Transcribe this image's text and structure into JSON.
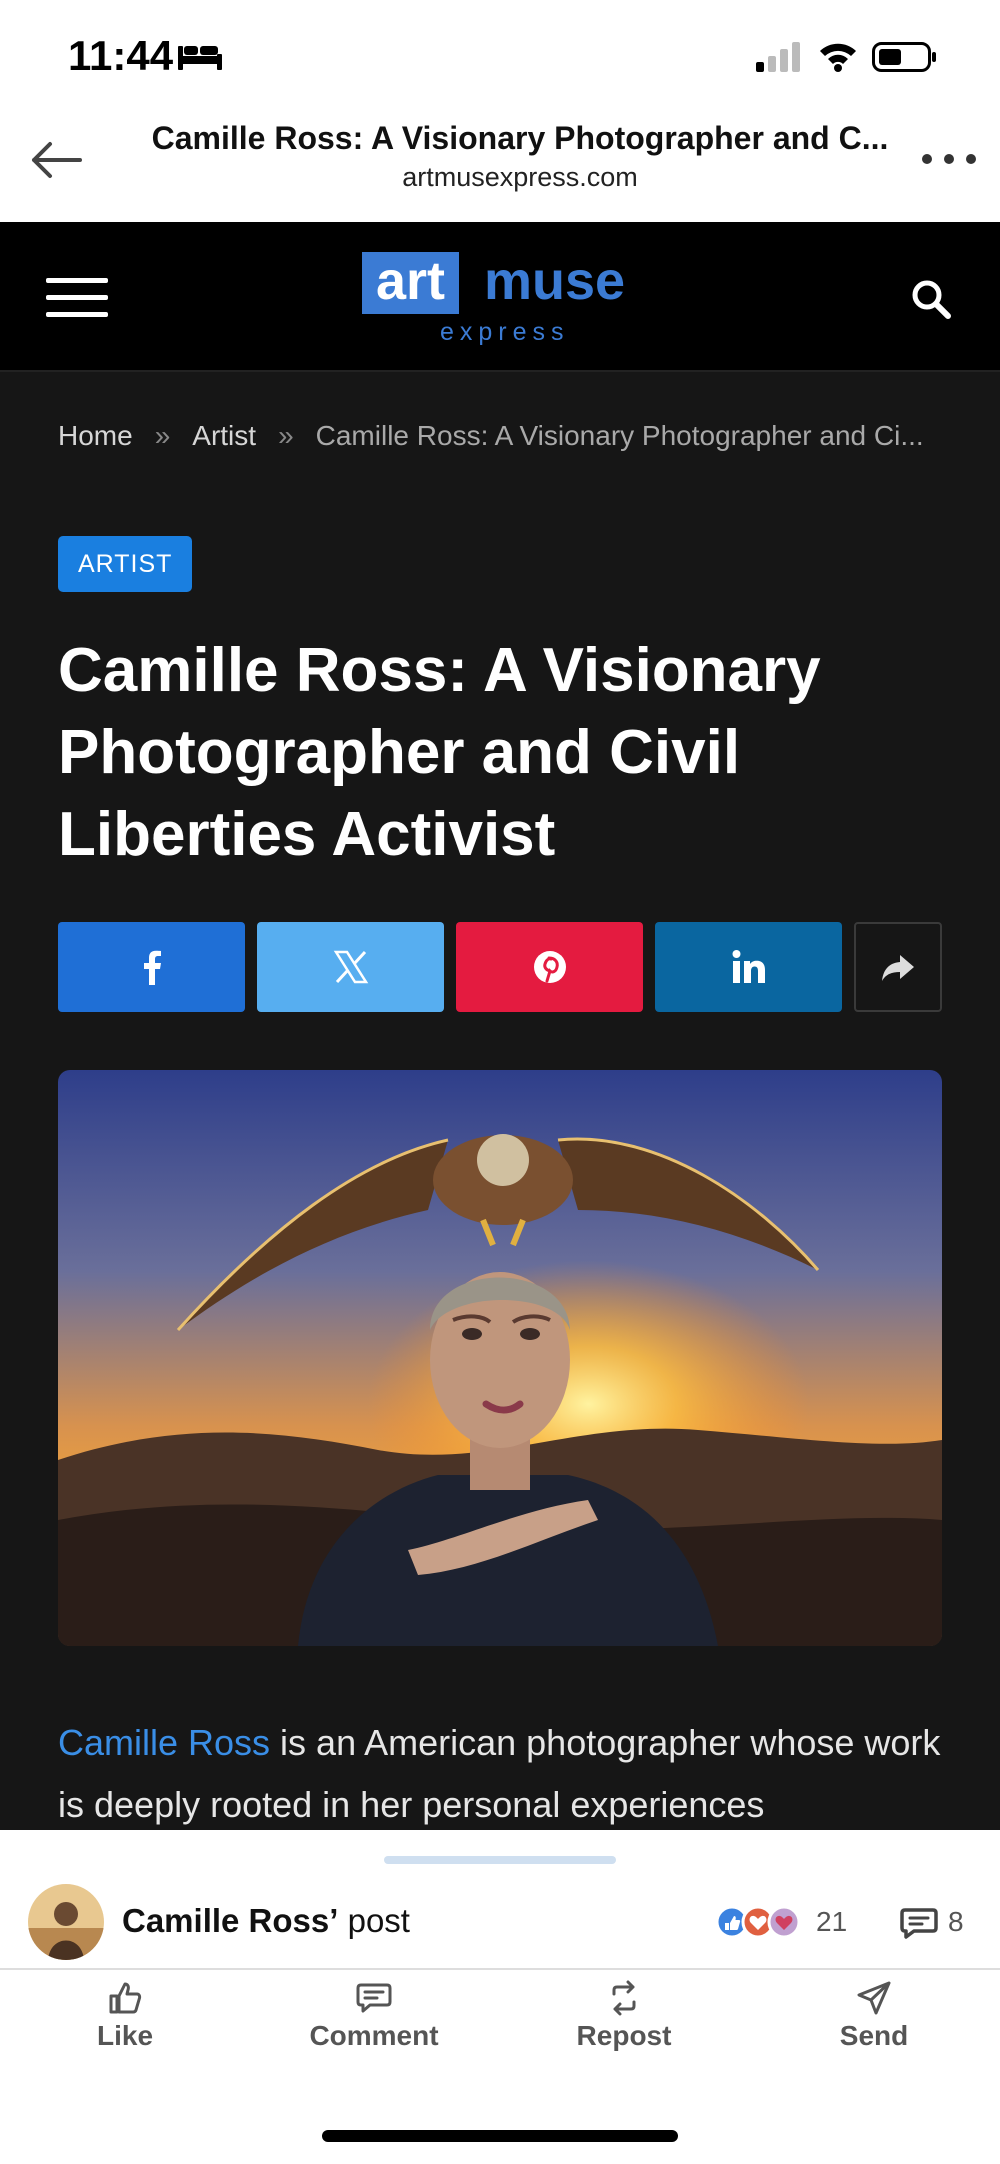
{
  "status_bar": {
    "time": "11:44"
  },
  "browser": {
    "title": "Camille Ross: A Visionary Photographer and C...",
    "domain": "artmusexpress.com"
  },
  "site": {
    "logo_art": "art",
    "logo_muse": "muse",
    "logo_express": "express",
    "brand_color": "#3b7bd4"
  },
  "breadcrumb": {
    "home": "Home",
    "sep": "»",
    "artist": "Artist",
    "current": "Camille Ross: A Visionary Photographer and Ci..."
  },
  "article": {
    "category": "ARTIST",
    "headline": "Camille Ross: A Visionary Photographer and Civil Liberties Activist",
    "body_link": "Camille Ross",
    "body_text": " is an American photographer whose work is deeply rooted in her personal experiences",
    "share_colors": {
      "facebook": "#1f6fd6",
      "x": "#57aef0",
      "pinterest": "#e41b40",
      "linkedin": "#0a66a0"
    }
  },
  "post": {
    "author": "Camille Ross’",
    "suffix": " post",
    "reaction_count": "21",
    "comment_count": "8",
    "actions": {
      "like": "Like",
      "comment": "Comment",
      "repost": "Repost",
      "send": "Send"
    }
  }
}
